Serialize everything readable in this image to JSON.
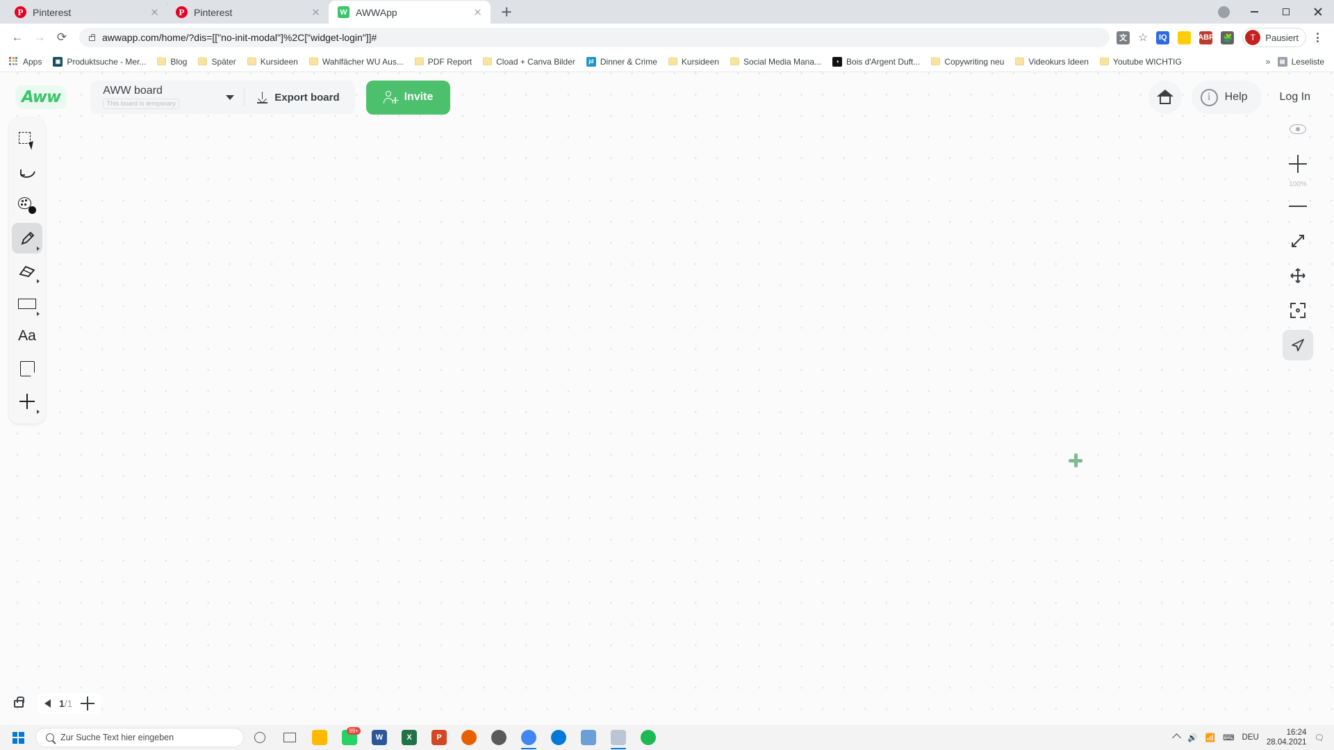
{
  "browser": {
    "tabs": [
      {
        "title": "Pinterest",
        "icon": "pinterest-icon",
        "active": false
      },
      {
        "title": "Pinterest",
        "icon": "pinterest-icon",
        "active": false
      },
      {
        "title": "AWWApp",
        "icon": "awwapp-icon",
        "active": true
      }
    ],
    "address": "awwapp.com/home/?dis=[[\"no-init-modal\"]%2C[\"widget-login\"]]#",
    "profile_label": "Pausiert",
    "profile_initial": "T",
    "extensions": [
      "translate-icon",
      "star-icon",
      "iq-icon",
      "extension-icon",
      "abp-icon",
      "puzzle-icon"
    ],
    "bookmarks": [
      {
        "label": "Apps",
        "icon": "apps-grid-icon"
      },
      {
        "label": "Produktsuche - Mer...",
        "icon": "site-icon",
        "color": "#1a4f5c"
      },
      {
        "label": "Blog",
        "icon": "folder-icon"
      },
      {
        "label": "Später",
        "icon": "folder-icon"
      },
      {
        "label": "Kursideen",
        "icon": "folder-icon"
      },
      {
        "label": "Wahlfächer WU Aus...",
        "icon": "folder-icon"
      },
      {
        "label": "PDF Report",
        "icon": "folder-icon"
      },
      {
        "label": "Cload + Canva Bilder",
        "icon": "folder-icon"
      },
      {
        "label": "Dinner & Crime",
        "icon": "site-icon",
        "color": "#2196c4",
        "text": "jd"
      },
      {
        "label": "Kursideen",
        "icon": "folder-icon"
      },
      {
        "label": "Social Media Mana...",
        "icon": "folder-icon"
      },
      {
        "label": "Bois d'Argent Duft...",
        "icon": "site-icon",
        "color": "#111111",
        "text": "◑"
      },
      {
        "label": "Copywriting neu",
        "icon": "folder-icon"
      },
      {
        "label": "Videokurs Ideen",
        "icon": "folder-icon"
      },
      {
        "label": "Youtube WICHTIG",
        "icon": "folder-icon"
      }
    ],
    "overflow_label": "»",
    "reading_list": "Leseliste"
  },
  "app": {
    "logo_text": "Aww",
    "board_name": "AWW board",
    "board_subtitle": "This board is temporary",
    "export_label": "Export board",
    "invite_label": "Invite",
    "help_label": "Help",
    "login_label": "Log In",
    "zoom_level": "100%",
    "page_current": "1",
    "page_total": "/1",
    "tools": [
      {
        "name": "select-tool",
        "label": "Select",
        "active": false
      },
      {
        "name": "undo-tool",
        "label": "Undo",
        "active": false
      },
      {
        "name": "color-tool",
        "label": "Color palette",
        "active": false
      },
      {
        "name": "pencil-tool",
        "label": "Pencil",
        "active": true
      },
      {
        "name": "eraser-tool",
        "label": "Eraser",
        "active": false
      },
      {
        "name": "shape-tool",
        "label": "Shape",
        "active": false
      },
      {
        "name": "text-tool",
        "label": "Aa",
        "active": false
      },
      {
        "name": "sticky-note-tool",
        "label": "Sticky note",
        "active": false
      },
      {
        "name": "more-tools",
        "label": "More",
        "active": false
      }
    ],
    "right_controls": [
      {
        "name": "visibility-toggle",
        "label": "Eye"
      },
      {
        "name": "zoom-in-button",
        "label": "+"
      },
      {
        "name": "zoom-out-button",
        "label": "−"
      },
      {
        "name": "fit-screen-button",
        "label": "Fit"
      },
      {
        "name": "pan-button",
        "label": "Pan"
      },
      {
        "name": "focus-button",
        "label": "Focus"
      },
      {
        "name": "pointer-button",
        "label": "Pointer"
      }
    ]
  },
  "taskbar": {
    "search_placeholder": "Zur Suche Text hier eingeben",
    "apps": [
      {
        "name": "file-explorer",
        "color": "#ffb900",
        "text": "",
        "badge": ""
      },
      {
        "name": "whatsapp",
        "color": "#25d366",
        "text": "",
        "badge": "99+"
      },
      {
        "name": "word",
        "color": "#2b579a",
        "text": "W",
        "badge": ""
      },
      {
        "name": "excel",
        "color": "#217346",
        "text": "X",
        "badge": ""
      },
      {
        "name": "powerpoint",
        "color": "#d24726",
        "text": "P",
        "badge": ""
      },
      {
        "name": "firefox",
        "color": "#e66000",
        "text": "",
        "badge": ""
      },
      {
        "name": "opera",
        "color": "#5a5a5a",
        "text": "",
        "badge": ""
      },
      {
        "name": "chrome",
        "color": "#4285f4",
        "text": "",
        "badge": ""
      },
      {
        "name": "edge",
        "color": "#0078d7",
        "text": "",
        "badge": ""
      },
      {
        "name": "photos",
        "color": "#6a9fd8",
        "text": "",
        "badge": ""
      },
      {
        "name": "paint",
        "color": "#b9c6d6",
        "text": "",
        "badge": ""
      },
      {
        "name": "spotify",
        "color": "#1db954",
        "text": "",
        "badge": ""
      }
    ],
    "language": "DEU",
    "time": "16:24",
    "date": "28.04.2021"
  }
}
